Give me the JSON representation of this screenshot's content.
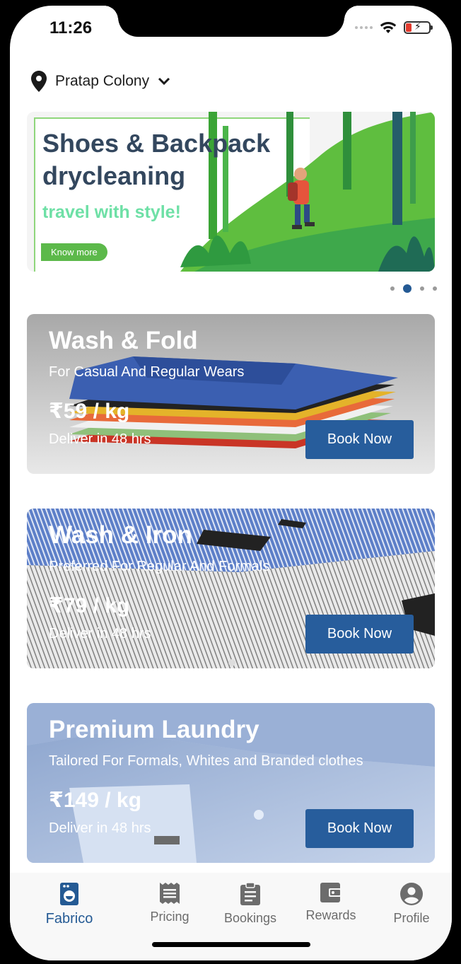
{
  "status_bar": {
    "time": "11:26"
  },
  "location": {
    "name": "Pratap Colony"
  },
  "banner": {
    "title_line1": "Shoes & Backpack",
    "title_line2": "drycleaning",
    "subtitle": "travel with style!",
    "cta": "Know more"
  },
  "carousel": {
    "dot_count": 4,
    "active_index": 1
  },
  "services": [
    {
      "title": "Wash & Fold",
      "description": "For Casual And Regular Wears",
      "price": "₹59 / kg",
      "eta": "Deliver in 48 hrs",
      "button": "Book Now"
    },
    {
      "title": "Wash & Iron",
      "description": "Preferred For Regular And Formals",
      "price": "₹79 / kg",
      "eta": "Deliver in 48 hrs",
      "button": "Book Now"
    },
    {
      "title": "Premium Laundry",
      "description": "Tailored For Formals, Whites and Branded clothes",
      "price": "₹149 / kg",
      "eta": "Deliver in 48 hrs",
      "button": "Book Now"
    }
  ],
  "bottom_nav": [
    {
      "label": "Fabrico",
      "icon": "washing-machine-icon",
      "active": true
    },
    {
      "label": "Pricing",
      "icon": "receipt-icon",
      "active": false
    },
    {
      "label": "Bookings",
      "icon": "clipboard-icon",
      "active": false
    },
    {
      "label": "Rewards",
      "icon": "wallet-icon",
      "active": false
    },
    {
      "label": "Profile",
      "icon": "account-icon",
      "active": false
    }
  ],
  "colors": {
    "primary": "#275d9c",
    "banner_title": "#33475e",
    "banner_subtitle": "#6ee0a6",
    "banner_cta": "#5cb94a"
  }
}
